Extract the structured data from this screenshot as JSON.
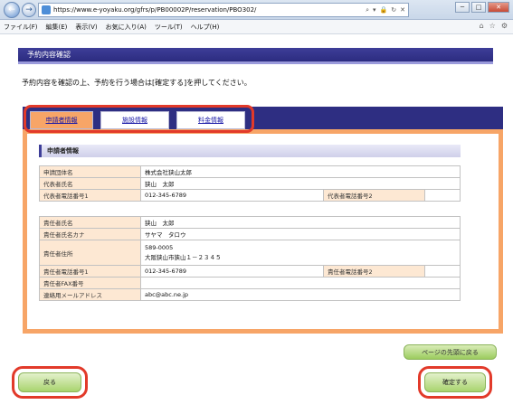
{
  "browser": {
    "url": "https://www.e-yoyaku.org/gfrs/p/PB00002P/reservation/PBO302/",
    "address_tools": [
      "⌕",
      "▾",
      "🔒",
      "↻",
      "✕"
    ],
    "window_controls": [
      "─",
      "□",
      "✕"
    ],
    "toolbar_icons": [
      "⌂",
      "☆",
      "⚙"
    ]
  },
  "menu": {
    "items": [
      "ファイル(F)",
      "編集(E)",
      "表示(V)",
      "お気に入り(A)",
      "ツール(T)",
      "ヘルプ(H)"
    ]
  },
  "page": {
    "section_title": "予約内容確認",
    "instruction": "予約内容を確認の上、予約を行う場合は[確定する]を押してください。",
    "tabs": [
      "申請者情報",
      "施設情報",
      "料金情報"
    ],
    "active_tab": 0,
    "applicant_heading": "申請者情報",
    "group1": {
      "org_name_label": "申請団体名",
      "org_name_value": "株式会社狭山太郎",
      "rep_name_label": "代表者氏名",
      "rep_name_value": "狭山　太郎",
      "rep_phone1_label": "代表者電話番号1",
      "rep_phone1_value": "012-345-6789",
      "rep_phone2_label": "代表者電話番号2",
      "rep_phone2_value": ""
    },
    "group2": {
      "resp_name_label": "責任者氏名",
      "resp_name_value": "狭山　太郎",
      "resp_kana_label": "責任者氏名カナ",
      "resp_kana_value": "サヤマ　タロウ",
      "resp_address_label": "責任者住所",
      "resp_postal_value": "589-0005",
      "resp_address_value": "大阪狭山市狭山１－２３４５",
      "resp_phone1_label": "責任者電話番号1",
      "resp_phone1_value": "012-345-6789",
      "resp_phone2_label": "責任者電話番号2",
      "resp_phone2_value": "",
      "resp_fax_label": "責任者FAX番号",
      "resp_fax_value": "",
      "contact_email_label": "連絡用メールアドレス",
      "contact_email_value": "abc@abc.ne.jp"
    },
    "back_to_top_label": "ページの先頭に戻る",
    "back_label": "戻る",
    "confirm_label": "確定する"
  },
  "colors": {
    "header_navy": "#2e2e82",
    "tab_active": "#f7a567",
    "highlight_red": "#e23a2a",
    "button_green": "#a9d46e"
  }
}
